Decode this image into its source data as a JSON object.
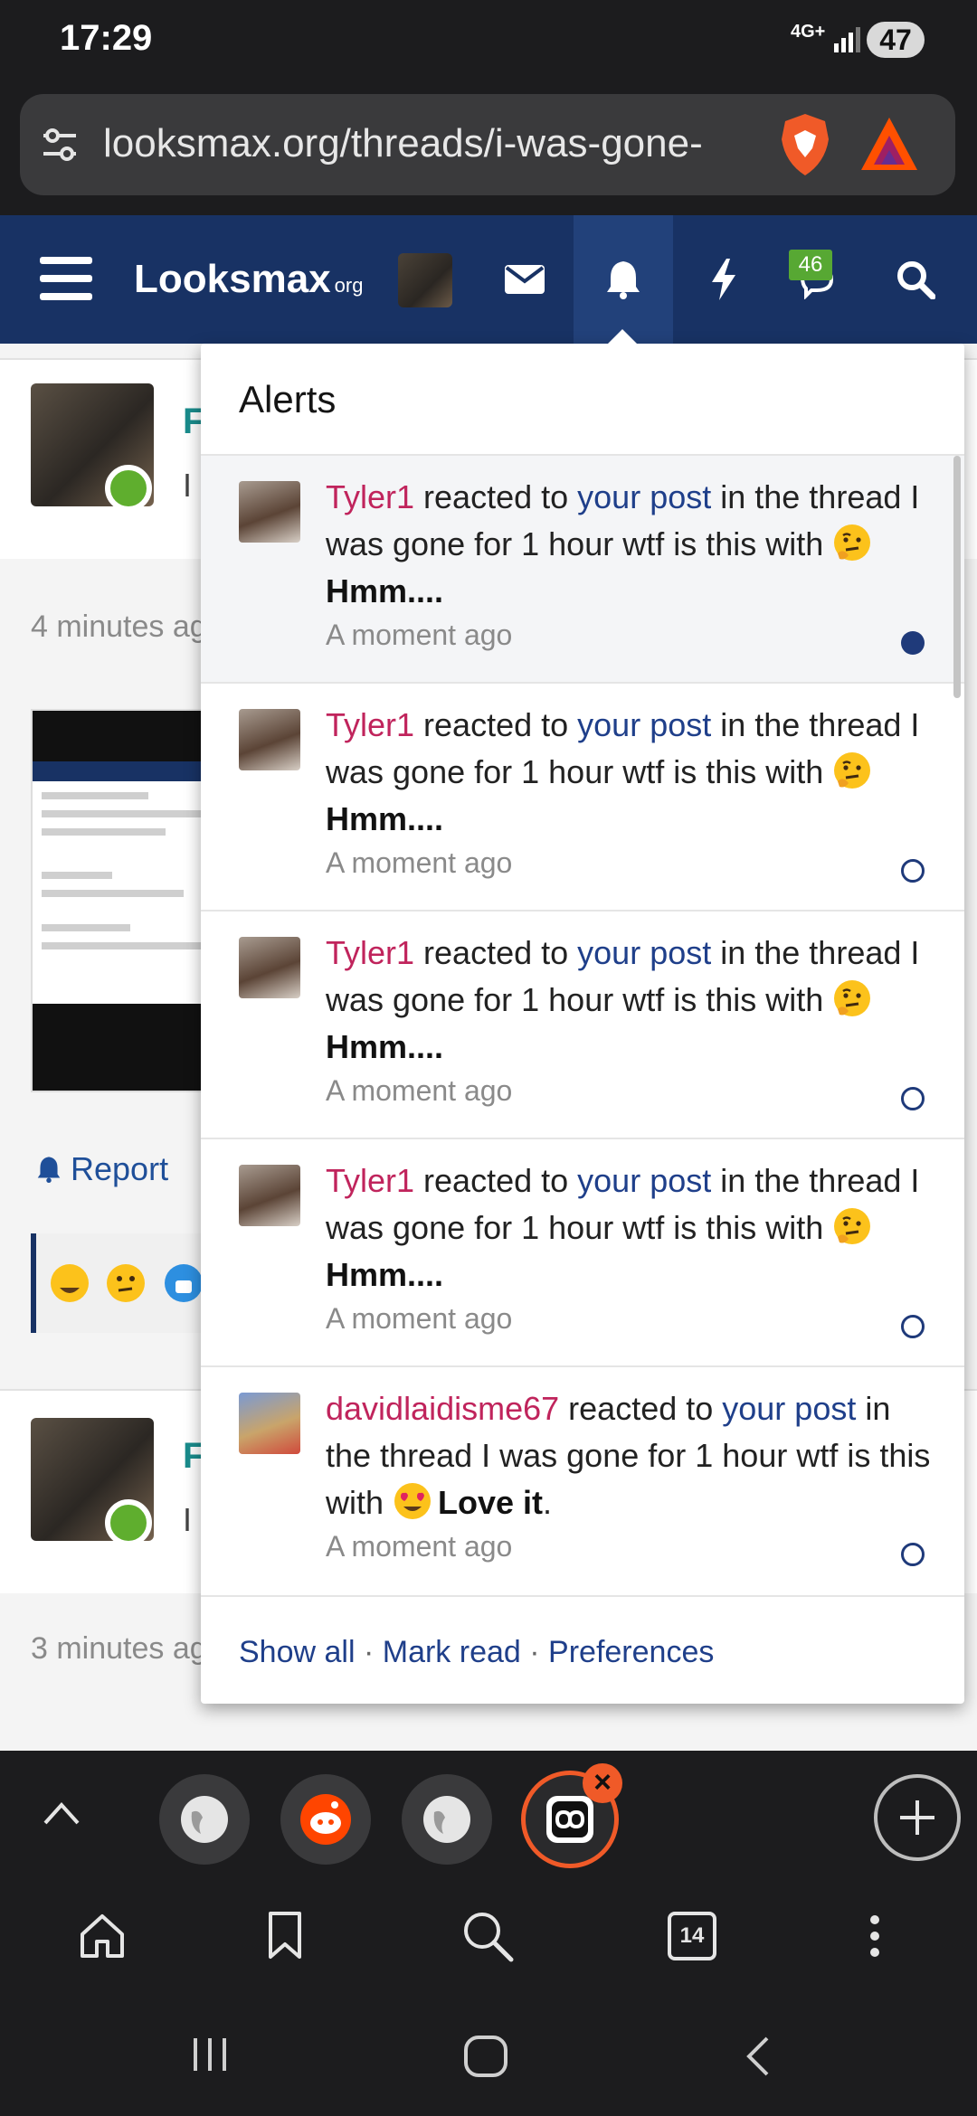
{
  "status_bar": {
    "time": "17:29",
    "network": "4G+",
    "battery": "47"
  },
  "address_bar": {
    "url": "looksmax.org/threads/i-was-gone-"
  },
  "site_header": {
    "logo": "Looksmax",
    "logo_suffix": "org",
    "conversations_count": "46"
  },
  "page": {
    "post1": {
      "name_initial": "F",
      "snippet_initial": "I"
    },
    "post1_time": "4 minutes ag",
    "report_label": "Report",
    "post2": {
      "name_initial": "F",
      "snippet_initial": "I"
    },
    "post2_time": "3 minutes ag"
  },
  "alerts": {
    "title": "Alerts",
    "items": [
      {
        "user": "Tyler1",
        "text_a": " reacted to ",
        "link": "your post",
        "text_b": " in the thread I was gone for 1 hour wtf is this with ",
        "reaction": "Hmm....",
        "reaction_emoji": "thinking-face",
        "suffix": "",
        "time": "A moment ago",
        "read": false
      },
      {
        "user": "Tyler1",
        "text_a": " reacted to ",
        "link": "your post",
        "text_b": " in the thread I was gone for 1 hour wtf is this with ",
        "reaction": "Hmm....",
        "reaction_emoji": "thinking-face",
        "suffix": "",
        "time": "A moment ago",
        "read": true
      },
      {
        "user": "Tyler1",
        "text_a": " reacted to ",
        "link": "your post",
        "text_b": " in the thread I was gone for 1 hour wtf is this with ",
        "reaction": "Hmm....",
        "reaction_emoji": "thinking-face",
        "suffix": "",
        "time": "A moment ago",
        "read": true
      },
      {
        "user": "Tyler1",
        "text_a": " reacted to ",
        "link": "your post",
        "text_b": " in the thread I was gone for 1 hour wtf is this with ",
        "reaction": "Hmm....",
        "reaction_emoji": "thinking-face",
        "suffix": "",
        "time": "A moment ago",
        "read": true
      },
      {
        "user": "davidlaidisme67",
        "text_a": " reacted to ",
        "link": "your post",
        "text_b": " in the thread I was gone for 1 hour wtf is this with ",
        "reaction": "Love it",
        "reaction_emoji": "heart-eyes-face",
        "suffix": ".",
        "time": "A moment ago",
        "read": true
      }
    ],
    "footer": {
      "show_all": "Show all",
      "mark_read": "Mark read",
      "preferences": "Preferences",
      "separator": "·"
    }
  },
  "browser": {
    "tab_count": "14"
  },
  "colors": {
    "header": "#183264",
    "accent_orange": "#f05a28",
    "username": "#c0245c",
    "link": "#1f3f8a"
  }
}
